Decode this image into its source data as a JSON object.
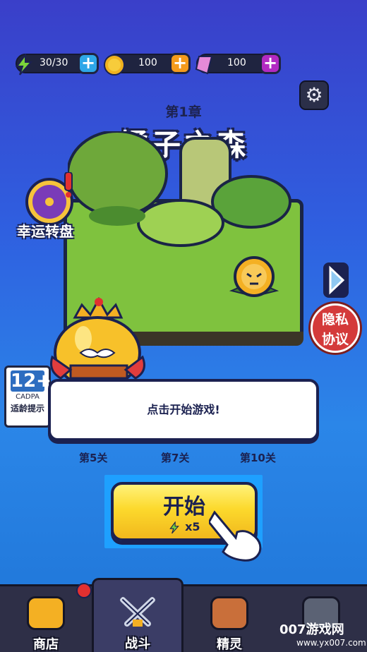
{
  "resources": [
    {
      "icon": "energy-icon",
      "value": "30/30",
      "plus_color": "#2ea7e8"
    },
    {
      "icon": "coin-icon",
      "value": "100",
      "plus_color": "#f59b1c"
    },
    {
      "icon": "gem-icon",
      "value": "100",
      "plus_color": "#b22ac2"
    }
  ],
  "chapter": {
    "subtitle": "第1章",
    "title": "橘子之森"
  },
  "lucky_wheel": {
    "label": "幸运转盘"
  },
  "privacy": {
    "label_line1": "隐私",
    "label_line2": "协议"
  },
  "age_rating": {
    "age": "12+",
    "org": "CADPA",
    "tip": "适龄提示"
  },
  "dialog": {
    "text": "点击开始游戏!"
  },
  "levels": [
    "第5关",
    "第7关",
    "第10关"
  ],
  "start_button": {
    "label": "开始",
    "cost": "x5"
  },
  "nav": [
    {
      "label": "商店",
      "active": false
    },
    {
      "label": "战斗",
      "active": true
    },
    {
      "label": "精灵",
      "active": false
    },
    {
      "label": "",
      "active": false
    }
  ],
  "watermark": {
    "brand": "007游戏网",
    "url": "www.yx007.com"
  }
}
